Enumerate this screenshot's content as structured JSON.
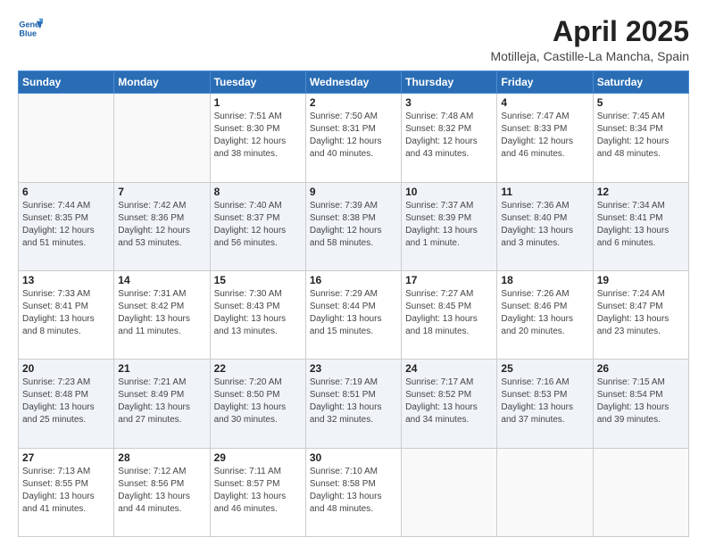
{
  "header": {
    "logo_line1": "General",
    "logo_line2": "Blue",
    "title": "April 2025",
    "subtitle": "Motilleja, Castille-La Mancha, Spain"
  },
  "days_of_week": [
    "Sunday",
    "Monday",
    "Tuesday",
    "Wednesday",
    "Thursday",
    "Friday",
    "Saturday"
  ],
  "weeks": [
    [
      {
        "day": "",
        "lines": []
      },
      {
        "day": "",
        "lines": []
      },
      {
        "day": "1",
        "lines": [
          "Sunrise: 7:51 AM",
          "Sunset: 8:30 PM",
          "Daylight: 12 hours",
          "and 38 minutes."
        ]
      },
      {
        "day": "2",
        "lines": [
          "Sunrise: 7:50 AM",
          "Sunset: 8:31 PM",
          "Daylight: 12 hours",
          "and 40 minutes."
        ]
      },
      {
        "day": "3",
        "lines": [
          "Sunrise: 7:48 AM",
          "Sunset: 8:32 PM",
          "Daylight: 12 hours",
          "and 43 minutes."
        ]
      },
      {
        "day": "4",
        "lines": [
          "Sunrise: 7:47 AM",
          "Sunset: 8:33 PM",
          "Daylight: 12 hours",
          "and 46 minutes."
        ]
      },
      {
        "day": "5",
        "lines": [
          "Sunrise: 7:45 AM",
          "Sunset: 8:34 PM",
          "Daylight: 12 hours",
          "and 48 minutes."
        ]
      }
    ],
    [
      {
        "day": "6",
        "lines": [
          "Sunrise: 7:44 AM",
          "Sunset: 8:35 PM",
          "Daylight: 12 hours",
          "and 51 minutes."
        ]
      },
      {
        "day": "7",
        "lines": [
          "Sunrise: 7:42 AM",
          "Sunset: 8:36 PM",
          "Daylight: 12 hours",
          "and 53 minutes."
        ]
      },
      {
        "day": "8",
        "lines": [
          "Sunrise: 7:40 AM",
          "Sunset: 8:37 PM",
          "Daylight: 12 hours",
          "and 56 minutes."
        ]
      },
      {
        "day": "9",
        "lines": [
          "Sunrise: 7:39 AM",
          "Sunset: 8:38 PM",
          "Daylight: 12 hours",
          "and 58 minutes."
        ]
      },
      {
        "day": "10",
        "lines": [
          "Sunrise: 7:37 AM",
          "Sunset: 8:39 PM",
          "Daylight: 13 hours",
          "and 1 minute."
        ]
      },
      {
        "day": "11",
        "lines": [
          "Sunrise: 7:36 AM",
          "Sunset: 8:40 PM",
          "Daylight: 13 hours",
          "and 3 minutes."
        ]
      },
      {
        "day": "12",
        "lines": [
          "Sunrise: 7:34 AM",
          "Sunset: 8:41 PM",
          "Daylight: 13 hours",
          "and 6 minutes."
        ]
      }
    ],
    [
      {
        "day": "13",
        "lines": [
          "Sunrise: 7:33 AM",
          "Sunset: 8:41 PM",
          "Daylight: 13 hours",
          "and 8 minutes."
        ]
      },
      {
        "day": "14",
        "lines": [
          "Sunrise: 7:31 AM",
          "Sunset: 8:42 PM",
          "Daylight: 13 hours",
          "and 11 minutes."
        ]
      },
      {
        "day": "15",
        "lines": [
          "Sunrise: 7:30 AM",
          "Sunset: 8:43 PM",
          "Daylight: 13 hours",
          "and 13 minutes."
        ]
      },
      {
        "day": "16",
        "lines": [
          "Sunrise: 7:29 AM",
          "Sunset: 8:44 PM",
          "Daylight: 13 hours",
          "and 15 minutes."
        ]
      },
      {
        "day": "17",
        "lines": [
          "Sunrise: 7:27 AM",
          "Sunset: 8:45 PM",
          "Daylight: 13 hours",
          "and 18 minutes."
        ]
      },
      {
        "day": "18",
        "lines": [
          "Sunrise: 7:26 AM",
          "Sunset: 8:46 PM",
          "Daylight: 13 hours",
          "and 20 minutes."
        ]
      },
      {
        "day": "19",
        "lines": [
          "Sunrise: 7:24 AM",
          "Sunset: 8:47 PM",
          "Daylight: 13 hours",
          "and 23 minutes."
        ]
      }
    ],
    [
      {
        "day": "20",
        "lines": [
          "Sunrise: 7:23 AM",
          "Sunset: 8:48 PM",
          "Daylight: 13 hours",
          "and 25 minutes."
        ]
      },
      {
        "day": "21",
        "lines": [
          "Sunrise: 7:21 AM",
          "Sunset: 8:49 PM",
          "Daylight: 13 hours",
          "and 27 minutes."
        ]
      },
      {
        "day": "22",
        "lines": [
          "Sunrise: 7:20 AM",
          "Sunset: 8:50 PM",
          "Daylight: 13 hours",
          "and 30 minutes."
        ]
      },
      {
        "day": "23",
        "lines": [
          "Sunrise: 7:19 AM",
          "Sunset: 8:51 PM",
          "Daylight: 13 hours",
          "and 32 minutes."
        ]
      },
      {
        "day": "24",
        "lines": [
          "Sunrise: 7:17 AM",
          "Sunset: 8:52 PM",
          "Daylight: 13 hours",
          "and 34 minutes."
        ]
      },
      {
        "day": "25",
        "lines": [
          "Sunrise: 7:16 AM",
          "Sunset: 8:53 PM",
          "Daylight: 13 hours",
          "and 37 minutes."
        ]
      },
      {
        "day": "26",
        "lines": [
          "Sunrise: 7:15 AM",
          "Sunset: 8:54 PM",
          "Daylight: 13 hours",
          "and 39 minutes."
        ]
      }
    ],
    [
      {
        "day": "27",
        "lines": [
          "Sunrise: 7:13 AM",
          "Sunset: 8:55 PM",
          "Daylight: 13 hours",
          "and 41 minutes."
        ]
      },
      {
        "day": "28",
        "lines": [
          "Sunrise: 7:12 AM",
          "Sunset: 8:56 PM",
          "Daylight: 13 hours",
          "and 44 minutes."
        ]
      },
      {
        "day": "29",
        "lines": [
          "Sunrise: 7:11 AM",
          "Sunset: 8:57 PM",
          "Daylight: 13 hours",
          "and 46 minutes."
        ]
      },
      {
        "day": "30",
        "lines": [
          "Sunrise: 7:10 AM",
          "Sunset: 8:58 PM",
          "Daylight: 13 hours",
          "and 48 minutes."
        ]
      },
      {
        "day": "",
        "lines": []
      },
      {
        "day": "",
        "lines": []
      },
      {
        "day": "",
        "lines": []
      }
    ]
  ]
}
